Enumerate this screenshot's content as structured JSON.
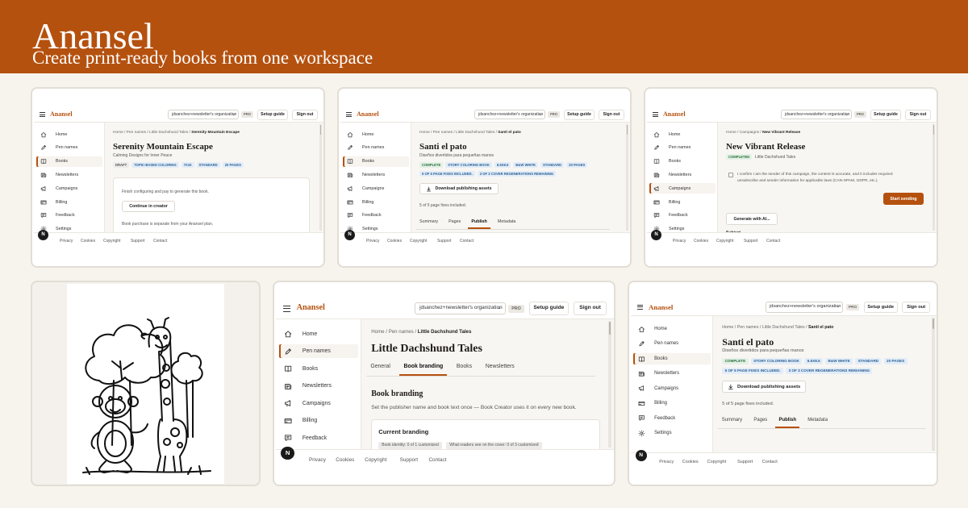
{
  "brand": {
    "title": "Anansel",
    "tagline": "Create print-ready books from one workspace"
  },
  "common": {
    "logo": "Anansel",
    "org": "jdsanchez+newsletter's organization",
    "pro": "PRO",
    "setup_guide": "Setup guide",
    "sign_out": "Sign out",
    "nav": [
      "Home",
      "Pen names",
      "Books",
      "Newsletters",
      "Campaigns",
      "Billing",
      "Feedback",
      "Settings"
    ],
    "nav_icons": [
      "home-icon",
      "pen-icon",
      "book-icon",
      "newsletter-icon",
      "megaphone-icon",
      "card-icon",
      "feedback-icon",
      "gear-icon"
    ],
    "footer": [
      "Privacy",
      "Cookies",
      "Copyright",
      "Support",
      "Contact"
    ],
    "nav_badge": "N",
    "colors": {
      "accent": "#b5510f",
      "banner": "#b5510f",
      "page_bg": "#f7f4ee"
    }
  },
  "shot1": {
    "breadcrumb": [
      "Home",
      "Pen names",
      "Little Dachshund Tales"
    ],
    "breadcrumb_current": "Serenity Mountain Escape",
    "title": "Serenity Mountain Escape",
    "subtitle": "Calming Designs for Inner Peace",
    "tags": [
      "DRAFT",
      "TOPIC-BASED COLORING",
      "7X10",
      "STANDARD",
      "20 PAGES"
    ],
    "message": "Finish configuring and pay to generate this book.",
    "button": "Continue in creator",
    "note": "Book purchase is separate from your Anansel plan."
  },
  "shot2": {
    "breadcrumb": [
      "Home",
      "Pen names",
      "Little Dachshund Tales"
    ],
    "breadcrumb_current": "Santi el pato",
    "title": "Santi el pato",
    "subtitle": "Diseños divertidos para pequeñas manos",
    "tags": [
      "COMPLETE",
      "STORY COLORING BOOK",
      "6.5X8.5",
      "B&W WHITE",
      "STANDARD",
      "20 PAGES"
    ],
    "tags2": [
      "5 OF 5 PAGE FIXES INCLUDED.",
      "3 OF 3 COVER REGENERATIONS REMAINING"
    ],
    "button": "Download publishing assets",
    "note": "5 of 5 page fixes included.",
    "tabs": [
      "Summary",
      "Pages",
      "Publish",
      "Metadata"
    ],
    "active_tab": "Publish"
  },
  "shot3": {
    "breadcrumb": [
      "Home",
      "Campaigns"
    ],
    "breadcrumb_current": "New Vibrant Release",
    "title": "New Vibrant Release",
    "status": "COMPLETED",
    "pen_name": "Little Dachshund Tales",
    "consent_line1": "I confirm I am the sender of this campaign, the content is accurate, and it includes required",
    "consent_line2": "unsubscribe and sender information for applicable laws (CAN-SPAM, GDPR, etc.).",
    "start_button": "Start sending",
    "generate_button": "Generate with AI...",
    "subject_label": "Subject"
  },
  "shot5": {
    "breadcrumb": [
      "Home",
      "Pen names"
    ],
    "breadcrumb_current": "Little Dachshund Tales",
    "title": "Little Dachshund Tales",
    "tabs": [
      "General",
      "Book branding",
      "Books",
      "Newsletters"
    ],
    "active_tab": "Book branding",
    "section_title": "Book branding",
    "section_text": "Set the publisher name and book text once — Book Creator uses it on every new book.",
    "current_title": "Current branding",
    "pills": [
      "Book identity: 0 of 1 customized",
      "What readers see on the cover: 0 of 3 customized"
    ]
  }
}
